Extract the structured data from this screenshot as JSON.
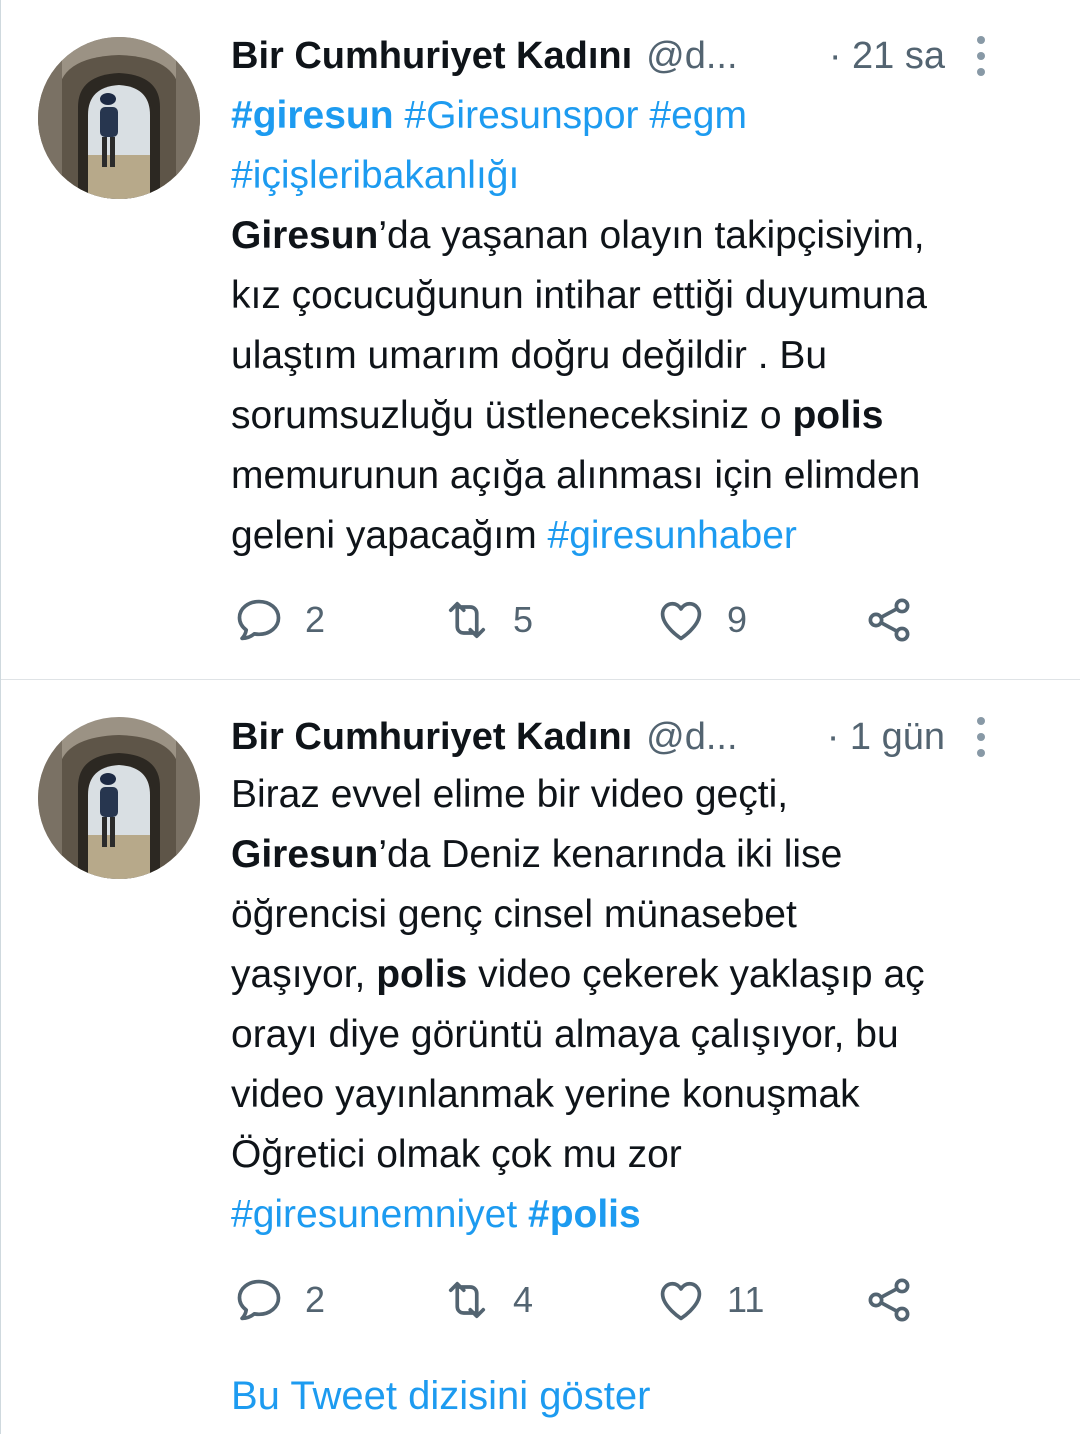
{
  "tweets": [
    {
      "author_name": "Bir Cumhuriyet Kadını",
      "handle": "@d...",
      "time": "· 21 sa",
      "text_lines": [
        [
          {
            "t": "#giresun",
            "s": "tag b"
          },
          {
            "t": " "
          },
          {
            "t": "#Giresunspor",
            "s": "tag"
          },
          {
            "t": " "
          },
          {
            "t": "#egm",
            "s": "tag"
          }
        ],
        [
          {
            "t": "#içişleribakanlığı",
            "s": "tag"
          }
        ],
        [
          {
            "t": "Giresun",
            "s": "b"
          },
          {
            "t": "’da yaşanan olayın takipçisiyim,"
          }
        ],
        [
          {
            "t": "kız çocucuğunun intihar ettiği duyumuna"
          }
        ],
        [
          {
            "t": "ulaştım umarım doğru değildir . Bu"
          }
        ],
        [
          {
            "t": "sorumsuzluğu üstleneceksiniz o "
          },
          {
            "t": "polis",
            "s": "b"
          }
        ],
        [
          {
            "t": "memurunun açığa alınması için elimden"
          }
        ],
        [
          {
            "t": "geleni yapacağım "
          },
          {
            "t": "#giresunhaber",
            "s": "tag"
          }
        ]
      ],
      "reply_count": "2",
      "retweet_count": "5",
      "like_count": "9"
    },
    {
      "author_name": "Bir Cumhuriyet Kadını",
      "handle": "@d...",
      "time": "· 1 gün",
      "text_lines": [
        [
          {
            "t": "Biraz evvel elime bir video geçti,"
          }
        ],
        [
          {
            "t": "Giresun",
            "s": "b"
          },
          {
            "t": "’da Deniz kenarında iki lise"
          }
        ],
        [
          {
            "t": "öğrencisi genç  cinsel münasebet"
          }
        ],
        [
          {
            "t": "yaşıyor, "
          },
          {
            "t": "polis",
            "s": "b"
          },
          {
            "t": " video çekerek yaklaşıp aç"
          }
        ],
        [
          {
            "t": "orayı diye görüntü almaya çalışıyor, bu"
          }
        ],
        [
          {
            "t": "video yayınlanmak yerine konuşmak"
          }
        ],
        [
          {
            "t": "Öğretici olmak çok mu zor"
          }
        ],
        [
          {
            "t": "#giresunemniyet",
            "s": "tag"
          },
          {
            "t": " "
          },
          {
            "t": "#polis",
            "s": "tag b"
          }
        ]
      ],
      "reply_count": "2",
      "retweet_count": "4",
      "like_count": "11",
      "thread_link": "Bu Tweet dizisini göster"
    }
  ],
  "icons": {
    "reply": "reply-icon",
    "retweet": "retweet-icon",
    "like": "heart-icon",
    "share": "share-icon",
    "more": "more-icon"
  },
  "colors": {
    "link": "#1d9bf0",
    "secondary_text": "#536471",
    "primary_text": "#0f1419"
  }
}
